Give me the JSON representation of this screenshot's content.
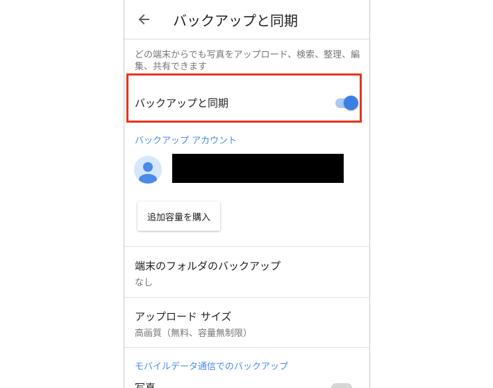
{
  "header": {
    "title": "バックアップと同期"
  },
  "description": "どの端末からでも写真をアップロード、検索、整理、編集、共有できます",
  "sync": {
    "label": "バックアップと同期",
    "enabled": true
  },
  "account_section": {
    "heading": "バックアップ アカウント",
    "buy_button": "追加容量を購入"
  },
  "settings": [
    {
      "title": "端末のフォルダのバックアップ",
      "value": "なし"
    },
    {
      "title": "アップロード サイズ",
      "value": "高画質（無料、容量無制限）"
    }
  ],
  "mobile_section": {
    "heading": "モバイルデータ通信でのバックアップ",
    "photos_label": "写真",
    "photos_enabled": false
  },
  "colors": {
    "accent": "#3b7ee6",
    "highlight": "#e8341c",
    "section_heading": "#4a8ae8"
  }
}
